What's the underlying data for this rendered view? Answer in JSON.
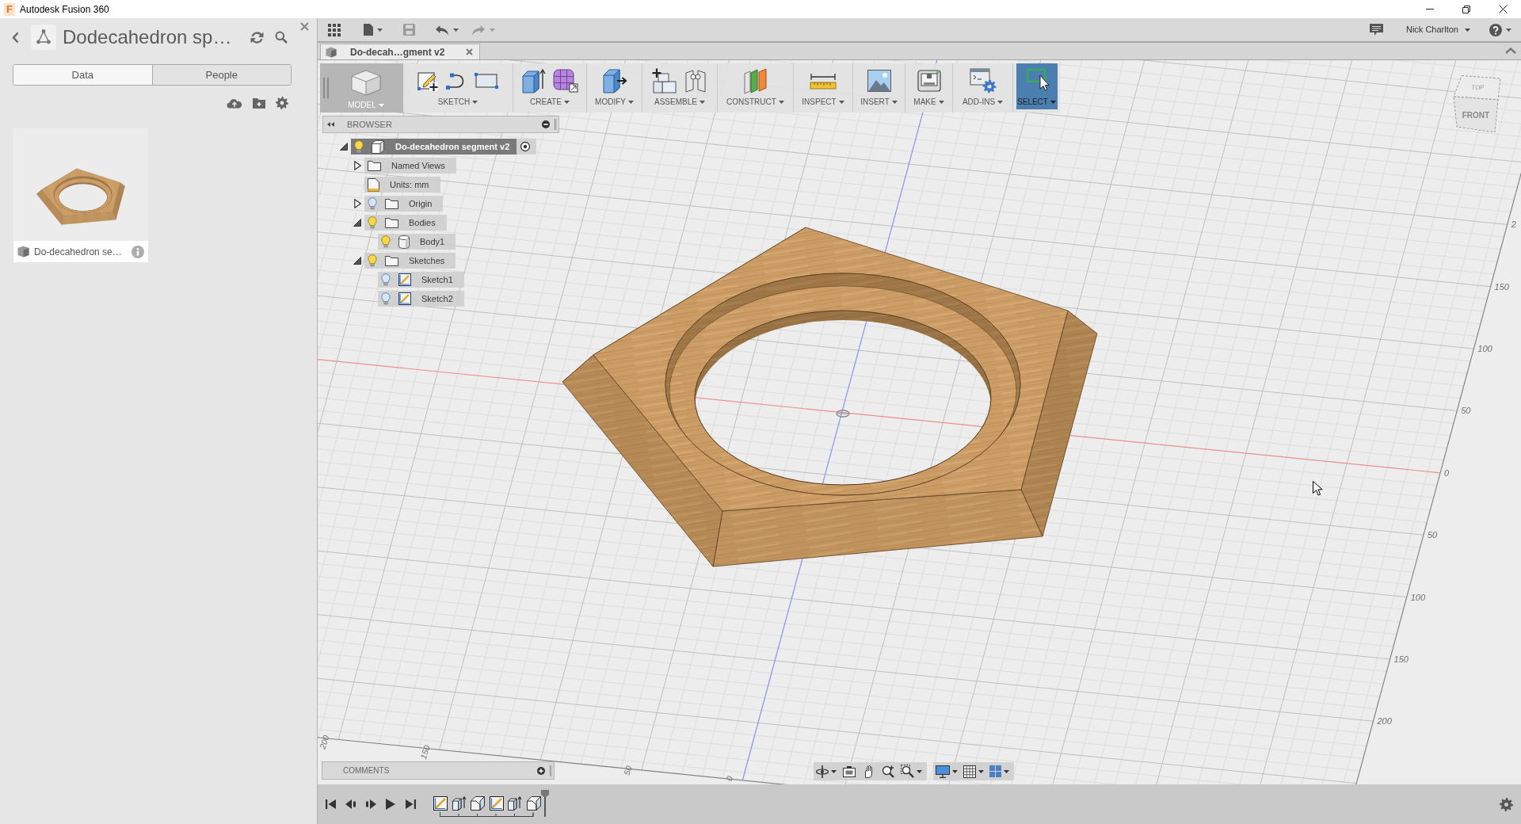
{
  "window": {
    "logo": "F",
    "title": "Autodesk Fusion 360"
  },
  "data_panel": {
    "project_title": "Dodecahedron sp…",
    "tabs": [
      {
        "label": "Data",
        "selected": true
      },
      {
        "label": "People",
        "selected": false
      }
    ],
    "files": [
      {
        "name": "Do-decahedron se…"
      }
    ]
  },
  "app_bar": {
    "save": {
      "disabled": true
    },
    "undo": {
      "disabled": false
    },
    "redo": {
      "disabled": true
    },
    "user": "Nick Charlton"
  },
  "document_tabs": [
    {
      "label": "Do-decah…gment v2",
      "selected": true
    }
  ],
  "toolbar": [
    {
      "kind": "workspace",
      "label": "MODEL"
    },
    {
      "kind": "sketch",
      "label": "SKETCH",
      "selected": false
    },
    {
      "kind": "create",
      "label": "CREATE",
      "selected": false
    },
    {
      "kind": "modify",
      "label": "MODIFY",
      "selected": false
    },
    {
      "kind": "assemble",
      "label": "ASSEMBLE",
      "selected": false
    },
    {
      "kind": "construct",
      "label": "CONSTRUCT",
      "selected": false
    },
    {
      "kind": "inspect",
      "label": "INSPECT",
      "selected": false
    },
    {
      "kind": "insert",
      "label": "INSERT",
      "selected": false
    },
    {
      "kind": "make",
      "label": "MAKE",
      "selected": false
    },
    {
      "kind": "addins",
      "label": "ADD-INS",
      "selected": false
    },
    {
      "kind": "select",
      "label": "SELECT",
      "selected": true
    }
  ],
  "browser": {
    "title": "BROWSER",
    "root": {
      "name": "Do-decahedron segment v2",
      "kind": "component",
      "visible": true,
      "expanded": true,
      "active": true,
      "children": [
        {
          "name": "Named Views",
          "kind": "folder",
          "expanded": false
        },
        {
          "name": "Units: mm",
          "kind": "units"
        },
        {
          "name": "Origin",
          "kind": "folder",
          "visible": false,
          "expanded": false
        },
        {
          "name": "Bodies",
          "kind": "folder",
          "visible": true,
          "expanded": true,
          "children": [
            {
              "name": "Body1",
              "kind": "body",
              "visible": true
            }
          ]
        },
        {
          "name": "Sketches",
          "kind": "folder",
          "visible": true,
          "expanded": true,
          "children": [
            {
              "name": "Sketch1",
              "kind": "sketch",
              "visible": false
            },
            {
              "name": "Sketch2",
              "kind": "sketch",
              "visible": false
            }
          ]
        }
      ]
    }
  },
  "view_cube": {
    "top": "TOP",
    "front": "FRONT"
  },
  "viewport": {
    "right_scale": [
      "2",
      "150",
      "100",
      "50",
      "0",
      "50",
      "100",
      "150",
      "200"
    ],
    "bottom_scale": [
      "200",
      "150",
      "50",
      "0"
    ]
  },
  "comments": {
    "title": "COMMENTS"
  },
  "timeline": {
    "features": [
      {
        "kind": "sketch"
      },
      {
        "kind": "extrude"
      },
      {
        "kind": "fillet"
      },
      {
        "kind": "sketch"
      },
      {
        "kind": "extrude"
      },
      {
        "kind": "fillet"
      }
    ]
  }
}
